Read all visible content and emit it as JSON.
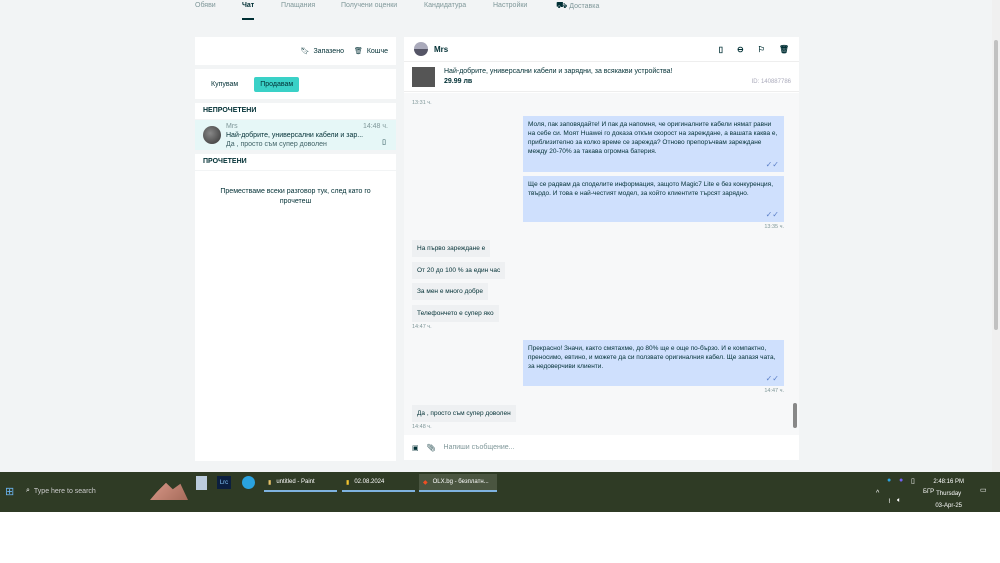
{
  "nav": {
    "items": [
      "Обяви",
      "Чат",
      "Плащания",
      "Получени оценки",
      "Кандидатура",
      "Настройки",
      "Доставка"
    ],
    "active": "Чат"
  },
  "left": {
    "saved": "Запазено",
    "trash": "Кошче",
    "tab_buy": "Купувам",
    "tab_sell": "Продавам",
    "unread": "НЕПРОЧЕТЕНИ",
    "read": "ПРОЧЕТЕНИ",
    "conversation": {
      "name": "Mrs",
      "title": "Най-добрите, универсални кабели и зар...",
      "last": "Да , просто съм супер доволен",
      "time": "14:48 ч."
    },
    "empty_text": "Преместваме всеки разговор тук, след като го прочетеш"
  },
  "chat": {
    "name": "Mrs",
    "ad_title": "Най-добрите, универсални кабели и зарядни, за всякакви устройства!",
    "ad_price": "29.99 лв",
    "ad_id": "ID: 140887786",
    "messages": [
      {
        "dir": "time",
        "text": "13:31 ч."
      },
      {
        "dir": "out",
        "text": "Моля, пак заповядайте! И пак да напомня, че оригиналните кабели нямат равни на себе си. Моят Huawei го доказа откъм скорост на зареждане, а вашата каква е, приблизително за колко време се зарежда? Отново препоръчвам зареждане между 20-70% за такава огромна батерия."
      },
      {
        "dir": "out",
        "text": "Ще се радвам да споделите информация, защото Magic7 Lite е без конкуренция, твърдо. И това е най-честият модел, за който клиентите търсят зарядно."
      },
      {
        "dir": "time",
        "text": "13:35 ч."
      },
      {
        "dir": "in",
        "text": "На първо зареждане е"
      },
      {
        "dir": "in",
        "text": "От 20 до 100 % за един час"
      },
      {
        "dir": "in",
        "text": "За мен  е много добре"
      },
      {
        "dir": "in",
        "text": "Телефончето е супер яко"
      },
      {
        "dir": "time",
        "text": "14:47 ч."
      },
      {
        "dir": "out",
        "text": "Прекрасно! Значи, както смятахме, до 80% ще е още по-бързо. И е компактно, преносимо, евтино, и можете да си ползвате оригиналния кабел. Ще запазя чата, за недоверчиви клиенти."
      },
      {
        "dir": "time",
        "text": "14:47 ч."
      },
      {
        "dir": "in",
        "text": "Да , просто съм супер доволен"
      },
      {
        "dir": "time",
        "text": "14:48 ч."
      }
    ],
    "composer_placeholder": "Напиши съобщение..."
  },
  "taskbar": {
    "search": "Type here to search",
    "apps": [
      "untitled - Paint",
      "02.08.2024",
      "OLX.bg - безплатн..."
    ],
    "lang": "БГР",
    "time": "2:48:16 PM",
    "day": "Thursday",
    "date": "03-Apr-25"
  },
  "colors": {
    "accent": "#3ad1c7",
    "outgoing": "#cfe0fd",
    "taskbar": "#2f3b25"
  }
}
